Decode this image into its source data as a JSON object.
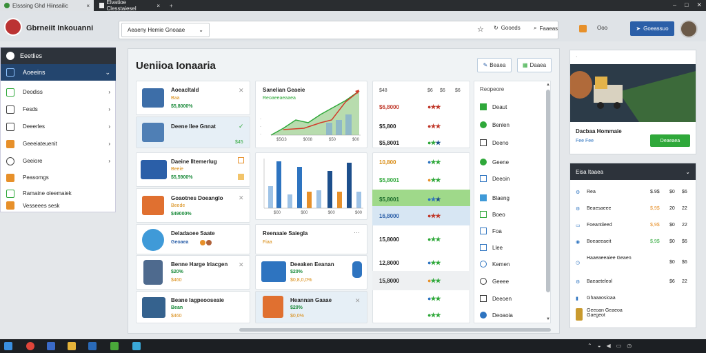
{
  "browser": {
    "tabs": [
      {
        "label": "Elsssing Ghd Hiinsailic",
        "close": "×"
      },
      {
        "label": "Elvatioe Clesstaiesel",
        "close": "×"
      }
    ],
    "new_tab": "+"
  },
  "header": {
    "title": "Gbrneiit Inkouanni",
    "select_value": "Aeaeny Hemie Gnoaae",
    "actions": [
      "Gooeds",
      "Faaeas",
      "Ooo"
    ],
    "share_label": "Goeassuo"
  },
  "sidebar": {
    "header": "Eeetlies",
    "active": "Aoeeins",
    "items": [
      "Deodiss",
      "Fesds",
      "Deeerles",
      "Geeeiateuenit",
      "Geeiore",
      "Peasomgs",
      "Ramaine oleemaiek",
      "Vesseees sesk"
    ]
  },
  "main": {
    "title": "Ueniioa Ionaaria",
    "toolbar": [
      "Beaea",
      "Daaea"
    ],
    "cards": [
      {
        "title": "Aoeacltald",
        "sub": "Baa",
        "value": "$5,8000%"
      },
      {
        "title": "Deene Ilee Gnnat",
        "sub": "",
        "value": "",
        "badge": "$45"
      },
      {
        "title": "Daeine Iltemerlug",
        "sub": "Beeie",
        "value": "$5,5900%"
      },
      {
        "title": "Goaotnes Doeanglo",
        "sub": "Beede",
        "value": "$49000%"
      },
      {
        "title": "Deladaoee Saate",
        "sub": "Geoaea",
        "value": ""
      },
      {
        "title": "Benne Harge Iriacgen",
        "sub": "$20%",
        "value": "$460"
      },
      {
        "title": "Beane Iagpeooseaie",
        "sub": "Bean",
        "value": "$460"
      }
    ],
    "chart_card": {
      "title": "Sanelian Geaeie",
      "legend": "Reoaeeaeaaea",
      "ticks": [
        "$5G3",
        "$008",
        "$50",
        "$00"
      ]
    },
    "bar_card": {
      "ticks": [
        "$00",
        "$00",
        "$00",
        "$00"
      ]
    },
    "mid_cards": [
      {
        "title": "Reenaaie Saiegla",
        "sub": "Fiaa"
      },
      {
        "title": "Deeaken Eeanan",
        "sub": "$20%",
        "value": "$0,8,0,0%"
      },
      {
        "title": "Heannan Gaaae",
        "sub": "$20%",
        "value": "$0,0%"
      }
    ],
    "price_table": {
      "header": [
        "$48",
        "$6",
        "$6",
        "$6"
      ],
      "rows": [
        "$6,8000",
        "$5,800",
        "$5,8001",
        "10,800",
        "$5,8001",
        "$5,8001",
        "16,8000",
        "15,8000",
        "12,8000",
        "15,8000"
      ]
    },
    "list": {
      "header": "Reopeore",
      "items": [
        "Deaut",
        "Benlen",
        "Deeno",
        "Geene",
        "Deeoin",
        "Blaeng",
        "Boeo",
        "Foa",
        "Llee",
        "Kemen",
        "Geeee",
        "Deeoen",
        "Deoaoia"
      ]
    }
  },
  "promo": {
    "title": "Dacbaa Hommaie",
    "tag": "Fee Fee",
    "button": "Deaeaea"
  },
  "detail": {
    "header": "Eisa Itaaea",
    "rows": [
      {
        "label": "Rea",
        "value": "$.9$",
        "a": "$0",
        "b": "$6"
      },
      {
        "label": "Beaesaeee",
        "value": "$,9$",
        "a": "20",
        "b": "22"
      },
      {
        "label": "Foeantiieed",
        "value": "$,9$",
        "a": "$0",
        "b": "22"
      },
      {
        "label": "Boeaeeaeit",
        "value": "$,9$",
        "a": "$0",
        "b": "$6"
      },
      {
        "label": "Haaeaeeaiee Geaen",
        "value": "",
        "a": "$0",
        "b": "$6"
      },
      {
        "label": "Baeaeteleol",
        "value": "",
        "a": "$6",
        "b": "22"
      },
      {
        "label": "Ghaaaosioaa",
        "value": "",
        "a": "",
        "b": ""
      },
      {
        "label": "Geeoan Geaeoa Gaegeot",
        "value": "",
        "a": "",
        "b": ""
      }
    ]
  },
  "colors": {
    "accent": "#2b5fa8",
    "green": "#2fa83a",
    "orange": "#e7902a",
    "navy": "#23456e"
  }
}
